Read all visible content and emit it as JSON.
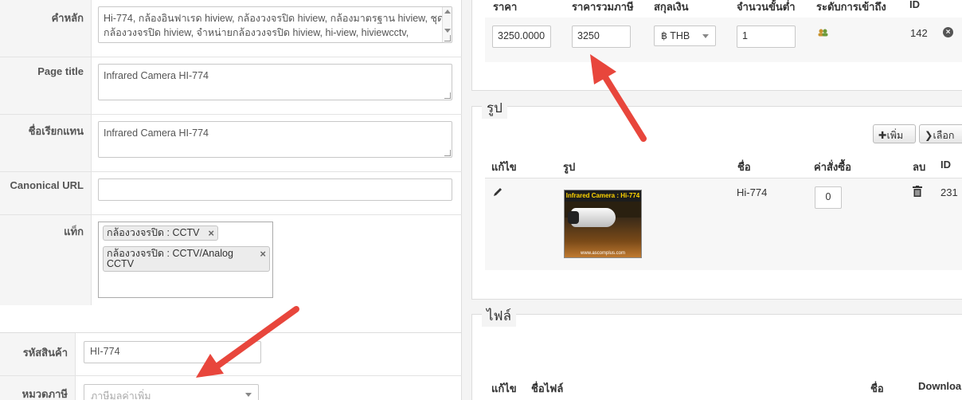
{
  "form": {
    "keywords": {
      "label": "คำหลัก",
      "value": "Hi-774, กล้องอินฟาเรด hiview, กล้องวงจรปิด hiview, กล้องมาตรฐาน hiview, ชุดกล้องวงจรปิด hiview, จำหน่ายกล้องวงจรปิด hiview, hi-view, hiviewcctv,"
    },
    "page_title": {
      "label": "Page title",
      "value": "Infrared Camera HI-774"
    },
    "alias": {
      "label": "ชื่อเรียกแทน",
      "value": "Infrared Camera HI-774"
    },
    "canonical": {
      "label": "Canonical URL",
      "value": ""
    },
    "tags": {
      "label": "แท็ก",
      "items": [
        {
          "text": "กล้องวงจรปิด : CCTV"
        },
        {
          "text": "กล้องวงจรปิด : CCTV/Analog CCTV"
        }
      ],
      "remove_glyph": "×"
    },
    "sku": {
      "label": "รหัสสินค้า",
      "value": "HI-774"
    },
    "tax_category": {
      "label": "หมวดภาษี",
      "placeholder": "ภาษีมูลค่าเพิ่ม"
    }
  },
  "prices": {
    "headers": [
      "ราคา",
      "ราคารวมภาษี",
      "สกุลเงิน",
      "จำนวนขั้นต่ำ",
      "ระดับการเข้าถึง",
      "ID"
    ],
    "row": {
      "price": "3250.0000",
      "price_incl_tax": "3250",
      "currency": "฿ THB",
      "min_qty": "1",
      "id": "142"
    }
  },
  "images": {
    "legend": "รูป",
    "add_label": "เพิ่ม",
    "select_label": "เลือก",
    "headers": {
      "edit": "แก้ไข",
      "image": "รูป",
      "name": "ชื่อ",
      "order": "ค่าสั่งซื้อ",
      "delete": "ลบ",
      "id": "ID"
    },
    "row": {
      "name": "Hi-774",
      "order": "0",
      "id": "231",
      "thumb_title": "Infrared Camera : Hi-774",
      "thumb_url": "www.ascomplus.com"
    }
  },
  "files": {
    "legend": "ไฟล์",
    "headers": {
      "edit": "แก้ไข",
      "filename": "ชื่อไฟล์",
      "name": "ชื่อ",
      "download": "Downloa"
    }
  },
  "colors": {
    "arrow": "#e8463c"
  }
}
